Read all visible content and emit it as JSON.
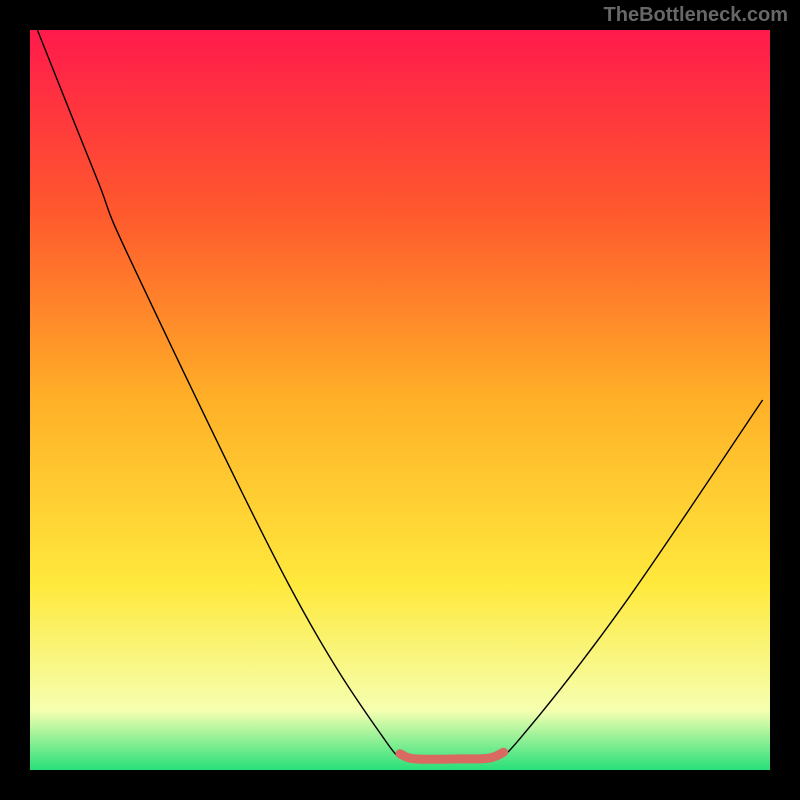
{
  "watermark": "TheBottleneck.com",
  "chart_data": {
    "type": "line",
    "title": "",
    "xlabel": "",
    "ylabel": "",
    "xlim": [
      0,
      100
    ],
    "ylim": [
      0,
      100
    ],
    "gradient_stops": [
      {
        "offset": 0,
        "color": "#ff1a4b"
      },
      {
        "offset": 25,
        "color": "#ff5a2d"
      },
      {
        "offset": 50,
        "color": "#ffb027"
      },
      {
        "offset": 75,
        "color": "#ffe93d"
      },
      {
        "offset": 92,
        "color": "#f5ffb0"
      },
      {
        "offset": 100,
        "color": "#27e07a"
      }
    ],
    "series": [
      {
        "name": "bottleneck-curve",
        "stroke": "#000000",
        "stroke_width": 1.4,
        "points": [
          {
            "x": 1,
            "y": 100
          },
          {
            "x": 9,
            "y": 80
          },
          {
            "x": 14,
            "y": 68
          },
          {
            "x": 35,
            "y": 25
          },
          {
            "x": 48,
            "y": 4
          },
          {
            "x": 51,
            "y": 2
          },
          {
            "x": 54,
            "y": 1.5
          },
          {
            "x": 60,
            "y": 1.5
          },
          {
            "x": 63,
            "y": 2
          },
          {
            "x": 66,
            "y": 4
          },
          {
            "x": 80,
            "y": 22
          },
          {
            "x": 99,
            "y": 50
          }
        ]
      },
      {
        "name": "flat-bottom-highlight",
        "stroke": "#d96a62",
        "stroke_width": 9,
        "linecap": "round",
        "points": [
          {
            "x": 50,
            "y": 2.2
          },
          {
            "x": 52,
            "y": 1.5
          },
          {
            "x": 58,
            "y": 1.5
          },
          {
            "x": 62,
            "y": 1.6
          },
          {
            "x": 64,
            "y": 2.4
          }
        ]
      }
    ]
  }
}
